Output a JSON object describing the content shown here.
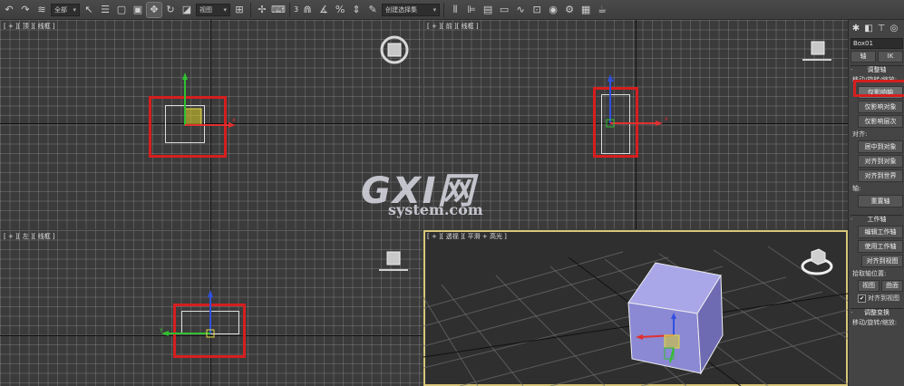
{
  "toolbar": {
    "select_filter": "全部",
    "view_dropdown": "视图",
    "snap_number": "3",
    "selection_set_placeholder": "创建选择集"
  },
  "viewports": {
    "top": {
      "label": "[ + ][ 顶 ][ 线框 ]"
    },
    "front": {
      "label": "[ + ][ 前 ][ 线框 ]"
    },
    "left": {
      "label": "[ + ][ 左 ][ 线框 ]"
    },
    "perspective": {
      "label": "[ + ][ 透视 ][ 平滑 + 高光 ]"
    },
    "axis_labels": {
      "x": "x",
      "y": "y",
      "z": "z"
    }
  },
  "panel": {
    "object_name": "Box01",
    "tabs": {
      "pivot": "轴",
      "ik": "IK"
    },
    "adjust_pivot": {
      "title": "调整轴",
      "move_rotate_scale": "移动/旋转/缩放:",
      "affect_pivot_only": "仅影响轴",
      "affect_object_only": "仅影响对象",
      "affect_hierarchy_only": "仅影响层次",
      "alignment_label": "对齐:",
      "center_to_object": "居中到对象",
      "align_to_object": "对齐到对象",
      "align_to_world": "对齐到世界",
      "pivot_label": "轴:",
      "reset_pivot": "重置轴"
    },
    "working_pivot": {
      "title": "工作轴",
      "edit_working_pivot": "编辑工作轴",
      "use_working_pivot": "使用工作轴",
      "align_to_view": "对齐到视图",
      "place_pivot_label": "拾取轴位置:",
      "view_button": "视图",
      "surface_button": "曲面",
      "align_to_view_check": "对齐到视图"
    },
    "adjust_transform": {
      "title": "调整变换",
      "move_rotate_scale": "移动/旋转/缩放:"
    }
  },
  "watermark": {
    "big": "GXI网",
    "small": "system.com"
  },
  "colors": {
    "highlight_red": "#d61e1e",
    "active_viewport_border": "#d8c77a",
    "gizmo_x": "#e03030",
    "gizmo_y": "#30c030",
    "gizmo_z": "#3050e0"
  }
}
